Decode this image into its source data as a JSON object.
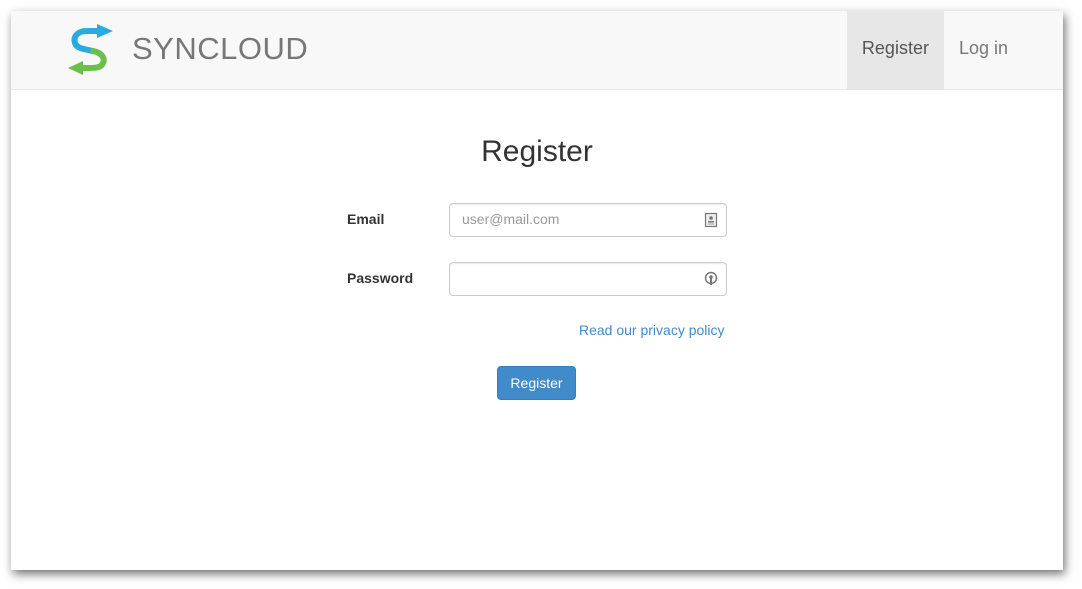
{
  "brand": {
    "name": "SYNCLOUD",
    "logo_icon": "syncloud-logo-icon"
  },
  "nav": {
    "items": [
      {
        "label": "Register",
        "active": true
      },
      {
        "label": "Log in",
        "active": false
      }
    ]
  },
  "form": {
    "title": "Register",
    "email": {
      "label": "Email",
      "value": "",
      "placeholder": "user@mail.com",
      "icon": "contact-card-icon"
    },
    "password": {
      "label": "Password",
      "value": "",
      "placeholder": "",
      "icon": "password-key-icon"
    },
    "privacy_link": "Read our privacy policy",
    "submit_label": "Register"
  },
  "colors": {
    "primary": "#428bca",
    "navbar_bg": "#f8f8f8",
    "nav_active_bg": "#e7e7e7",
    "logo_blue": "#29abe2",
    "logo_green": "#6cbf4a"
  }
}
